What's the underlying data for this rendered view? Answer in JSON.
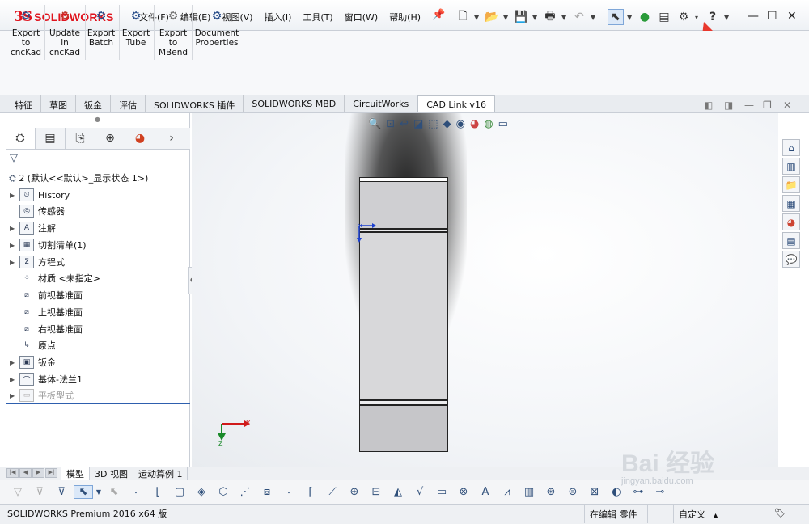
{
  "app": {
    "logo_ds": "3S",
    "logo_text": "SOLIDWORKS"
  },
  "menu": [
    "文件(F)",
    "编辑(E)",
    "视图(V)",
    "插入(I)",
    "工具(T)",
    "窗口(W)",
    "帮助(H)"
  ],
  "ribbon": {
    "buttons": [
      {
        "label": "Export to cncKad",
        "icon": "export-icon"
      },
      {
        "label": "Update in cncKad",
        "icon": "update-icon"
      },
      {
        "label": "Export Batch",
        "icon": "batch-icon"
      },
      {
        "label": "Export Tube",
        "icon": "tube-icon"
      },
      {
        "label": "Export to MBend",
        "icon": "mbend-icon"
      },
      {
        "label": "Document Properties",
        "icon": "properties-icon"
      }
    ]
  },
  "command_tabs": [
    "特征",
    "草图",
    "钣金",
    "评估",
    "SOLIDWORKS 插件",
    "SOLIDWORKS MBD",
    "CircuitWorks",
    "CAD Link v16"
  ],
  "tree": {
    "root": "2 (默认<<默认>_显示状态 1>)",
    "items": [
      {
        "label": "History",
        "icon": "history-folder-icon",
        "expandable": true,
        "dim": false
      },
      {
        "label": "传感器",
        "icon": "sensor-folder-icon",
        "expandable": false,
        "dim": false
      },
      {
        "label": "注解",
        "icon": "annotation-folder-icon",
        "expandable": true,
        "dim": false
      },
      {
        "label": "切割清单(1)",
        "icon": "cutlist-icon",
        "expandable": true,
        "dim": false
      },
      {
        "label": "方程式",
        "icon": "equation-folder-icon",
        "expandable": true,
        "dim": false
      },
      {
        "label": "材质 <未指定>",
        "icon": "material-icon",
        "expandable": false,
        "dim": false
      },
      {
        "label": "前视基准面",
        "icon": "plane-icon",
        "expandable": false,
        "dim": false
      },
      {
        "label": "上视基准面",
        "icon": "plane-icon",
        "expandable": false,
        "dim": false
      },
      {
        "label": "右视基准面",
        "icon": "plane-icon",
        "expandable": false,
        "dim": false
      },
      {
        "label": "原点",
        "icon": "origin-icon",
        "expandable": false,
        "dim": false
      },
      {
        "label": "钣金",
        "icon": "sheetmetal-icon",
        "expandable": true,
        "dim": false
      },
      {
        "label": "基体-法兰1",
        "icon": "base-flange-icon",
        "expandable": true,
        "dim": false
      },
      {
        "label": "平板型式",
        "icon": "flat-pattern-icon",
        "expandable": true,
        "dim": true
      }
    ]
  },
  "model_tabs": [
    "模型",
    "3D 视图",
    "运动算例 1"
  ],
  "status": {
    "product": "SOLIDWORKS Premium 2016 x64 版",
    "editing": "在编辑 零件",
    "units": "自定义"
  },
  "watermark": {
    "text": "Bai 经验",
    "url": "jingyan.baidu.com"
  },
  "colors": {
    "brand_red": "#e0141e",
    "annotation_arrow": "#e8372c",
    "tree_divider": "#2e5fae"
  }
}
